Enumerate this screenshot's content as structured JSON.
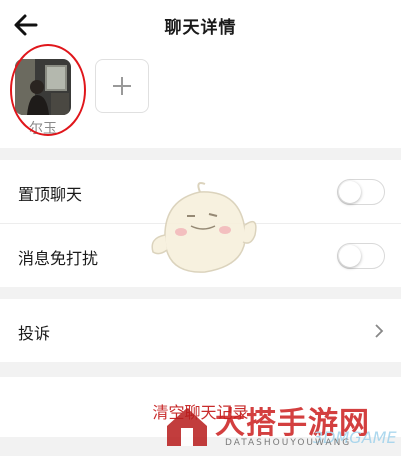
{
  "header": {
    "title": "聊天详情",
    "back_icon": "arrow-left-icon"
  },
  "members": [
    {
      "name": "尔玉"
    }
  ],
  "add_member_icon": "plus-icon",
  "settings": {
    "pin_chat": {
      "label": "置顶聊天",
      "enabled": false
    },
    "do_not_disturb": {
      "label": "消息免打扰",
      "enabled": false
    },
    "report": {
      "label": "投诉",
      "icon": "chevron-right-icon"
    }
  },
  "clear_history_label": "清空聊天记录",
  "watermark": {
    "brand": "大搭手游网",
    "sub": "DATASHOUYOUWANG",
    "sub2": "3DMGAME"
  },
  "colors": {
    "danger": "#c82c2c",
    "annotation": "#e0161b"
  }
}
